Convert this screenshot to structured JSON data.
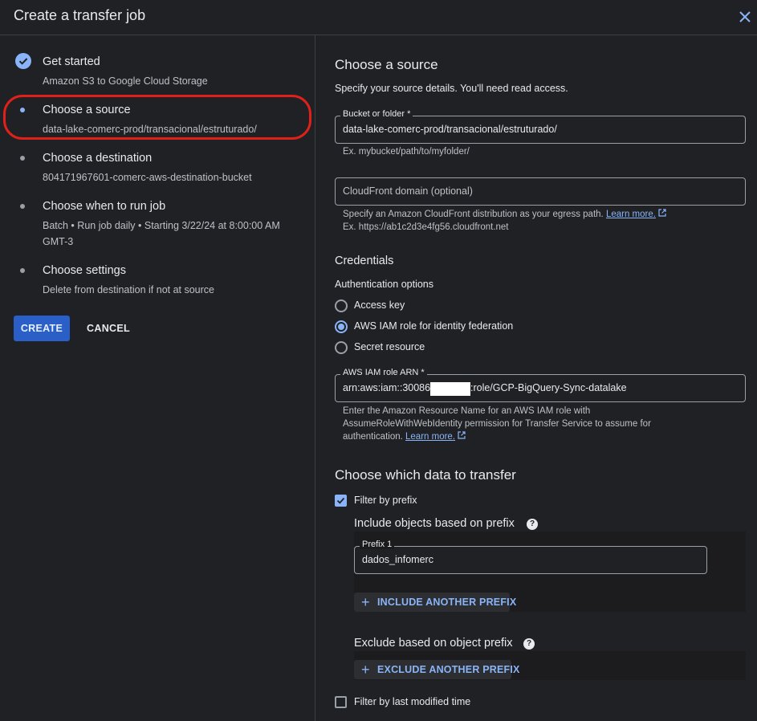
{
  "header": {
    "title": "Create a transfer job",
    "close_icon": "close-icon"
  },
  "sidebar": {
    "steps": [
      {
        "title": "Get started",
        "subtitle": "Amazon S3 to Google Cloud Storage",
        "state": "complete"
      },
      {
        "title": "Choose a source",
        "subtitle": "data-lake-comerc-prod/transacional/estruturado/",
        "state": "active"
      },
      {
        "title": "Choose a destination",
        "subtitle": "804171967601-comerc-aws-destination-bucket",
        "state": "pending"
      },
      {
        "title": "Choose when to run job",
        "subtitle": "Batch • Run job daily • Starting 3/22/24 at 8:00:00 AM GMT-3",
        "state": "pending"
      },
      {
        "title": "Choose settings",
        "subtitle": "Delete from destination if not at source",
        "state": "pending"
      }
    ],
    "create_label": "CREATE",
    "cancel_label": "CANCEL"
  },
  "main": {
    "title": "Choose a source",
    "description": "Specify your source details. You'll need read access.",
    "bucket": {
      "label": "Bucket or folder *",
      "value": "data-lake-comerc-prod/transacional/estruturado/",
      "hint": "Ex. mybucket/path/to/myfolder/"
    },
    "cloudfront": {
      "placeholder": "CloudFront domain (optional)",
      "hint_text": "Specify an Amazon CloudFront distribution as your egress path.",
      "hint_link": "Learn more.",
      "hint_example": "Ex. https://ab1c2d3e4fg56.cloudfront.net"
    },
    "credentials": {
      "title": "Credentials",
      "auth_label": "Authentication options",
      "options": [
        {
          "label": "Access key",
          "selected": false
        },
        {
          "label": "AWS IAM role for identity federation",
          "selected": true
        },
        {
          "label": "Secret resource",
          "selected": false
        }
      ],
      "arn": {
        "label": "AWS IAM role ARN *",
        "value_prefix": "arn:aws:iam::30086",
        "value_suffix": ":role/GCP-BigQuery-Sync-datalake",
        "hint_line1": "Enter the Amazon Resource Name for an AWS IAM role with",
        "hint_line2": "AssumeRoleWithWebIdentity permission for Transfer Service to assume for",
        "hint_line3": "authentication.",
        "hint_link": "Learn more."
      }
    },
    "data_transfer": {
      "title": "Choose which data to transfer",
      "filter_by_prefix": {
        "label": "Filter by prefix",
        "checked": true
      },
      "include_label": "Include objects based on prefix",
      "prefix1": {
        "label": "Prefix 1",
        "value": "dados_infomerc"
      },
      "include_another": "INCLUDE ANOTHER PREFIX",
      "exclude_label": "Exclude based on object prefix",
      "exclude_another": "EXCLUDE ANOTHER PREFIX",
      "filter_by_modified": {
        "label": "Filter by last modified time",
        "checked": false
      }
    }
  }
}
